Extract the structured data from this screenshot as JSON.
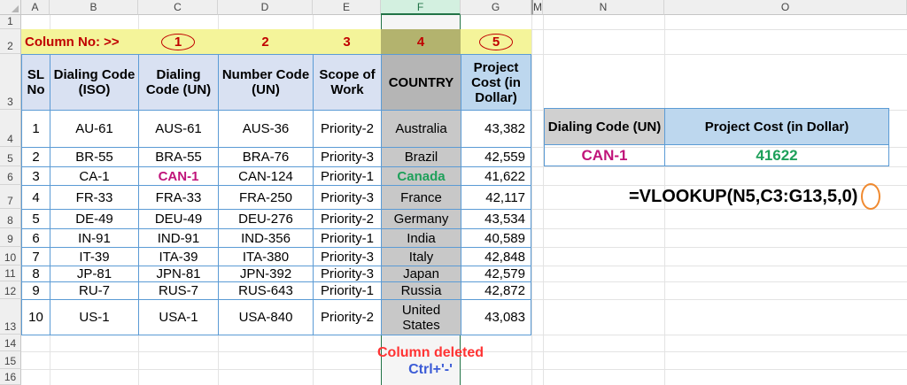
{
  "column_headers": [
    "A",
    "B",
    "C",
    "D",
    "E",
    "F",
    "G",
    "M",
    "N",
    "O"
  ],
  "row_headers": [
    "1",
    "2",
    "3",
    "4",
    "5",
    "6",
    "7",
    "8",
    "9",
    "10",
    "11",
    "12",
    "13",
    "14",
    "15",
    "16"
  ],
  "row2": {
    "label": "Column No: >>",
    "n1": "1",
    "n2": "2",
    "n3": "3",
    "n4": "4",
    "n5": "5"
  },
  "table_header": {
    "sl": "SL No",
    "iso": "Dialing Code (ISO)",
    "un": "Dialing Code (UN)",
    "num": "Number Code (UN)",
    "scope": "Scope of Work",
    "country": "COUNTRY",
    "cost": "Project Cost (in Dollar)"
  },
  "rows": [
    {
      "sl": "1",
      "iso": "AU-61",
      "un": "AUS-61",
      "num": "AUS-36",
      "scope": "Priority-2",
      "country": "Australia",
      "cost": "43,382"
    },
    {
      "sl": "2",
      "iso": "BR-55",
      "un": "BRA-55",
      "num": "BRA-76",
      "scope": "Priority-3",
      "country": "Brazil",
      "cost": "42,559"
    },
    {
      "sl": "3",
      "iso": "CA-1",
      "un": "CAN-1",
      "num": "CAN-124",
      "scope": "Priority-1",
      "country": "Canada",
      "cost": "41,622"
    },
    {
      "sl": "4",
      "iso": "FR-33",
      "un": "FRA-33",
      "num": "FRA-250",
      "scope": "Priority-3",
      "country": "France",
      "cost": "42,117"
    },
    {
      "sl": "5",
      "iso": "DE-49",
      "un": "DEU-49",
      "num": "DEU-276",
      "scope": "Priority-2",
      "country": "Germany",
      "cost": "43,534"
    },
    {
      "sl": "6",
      "iso": "IN-91",
      "un": "IND-91",
      "num": "IND-356",
      "scope": "Priority-1",
      "country": "India",
      "cost": "40,589"
    },
    {
      "sl": "7",
      "iso": "IT-39",
      "un": "ITA-39",
      "num": "ITA-380",
      "scope": "Priority-3",
      "country": "Italy",
      "cost": "42,848"
    },
    {
      "sl": "8",
      "iso": "JP-81",
      "un": "JPN-81",
      "num": "JPN-392",
      "scope": "Priority-3",
      "country": "Japan",
      "cost": "42,579"
    },
    {
      "sl": "9",
      "iso": "RU-7",
      "un": "RUS-7",
      "num": "RUS-643",
      "scope": "Priority-1",
      "country": "Russia",
      "cost": "42,872"
    },
    {
      "sl": "10",
      "iso": "US-1",
      "un": "USA-1",
      "num": "USA-840",
      "scope": "Priority-2",
      "country": "United States",
      "cost": "43,083"
    }
  ],
  "lookup": {
    "header_code": "Dialing Code (UN)",
    "header_cost": "Project Cost (in Dollar)",
    "code": "CAN-1",
    "cost": "41622"
  },
  "formula": "=VLOOKUP(N5,C3:G13,5,0)",
  "notes": {
    "deleted": "Column deleted",
    "shortcut": "Ctrl+'-'"
  },
  "colors": {
    "accent_blue": "#5b9bd5",
    "highlight_pink": "#c0147a",
    "highlight_green": "#1ea05a",
    "note_red": "#ff3333",
    "note_blue": "#3b5bd6"
  }
}
